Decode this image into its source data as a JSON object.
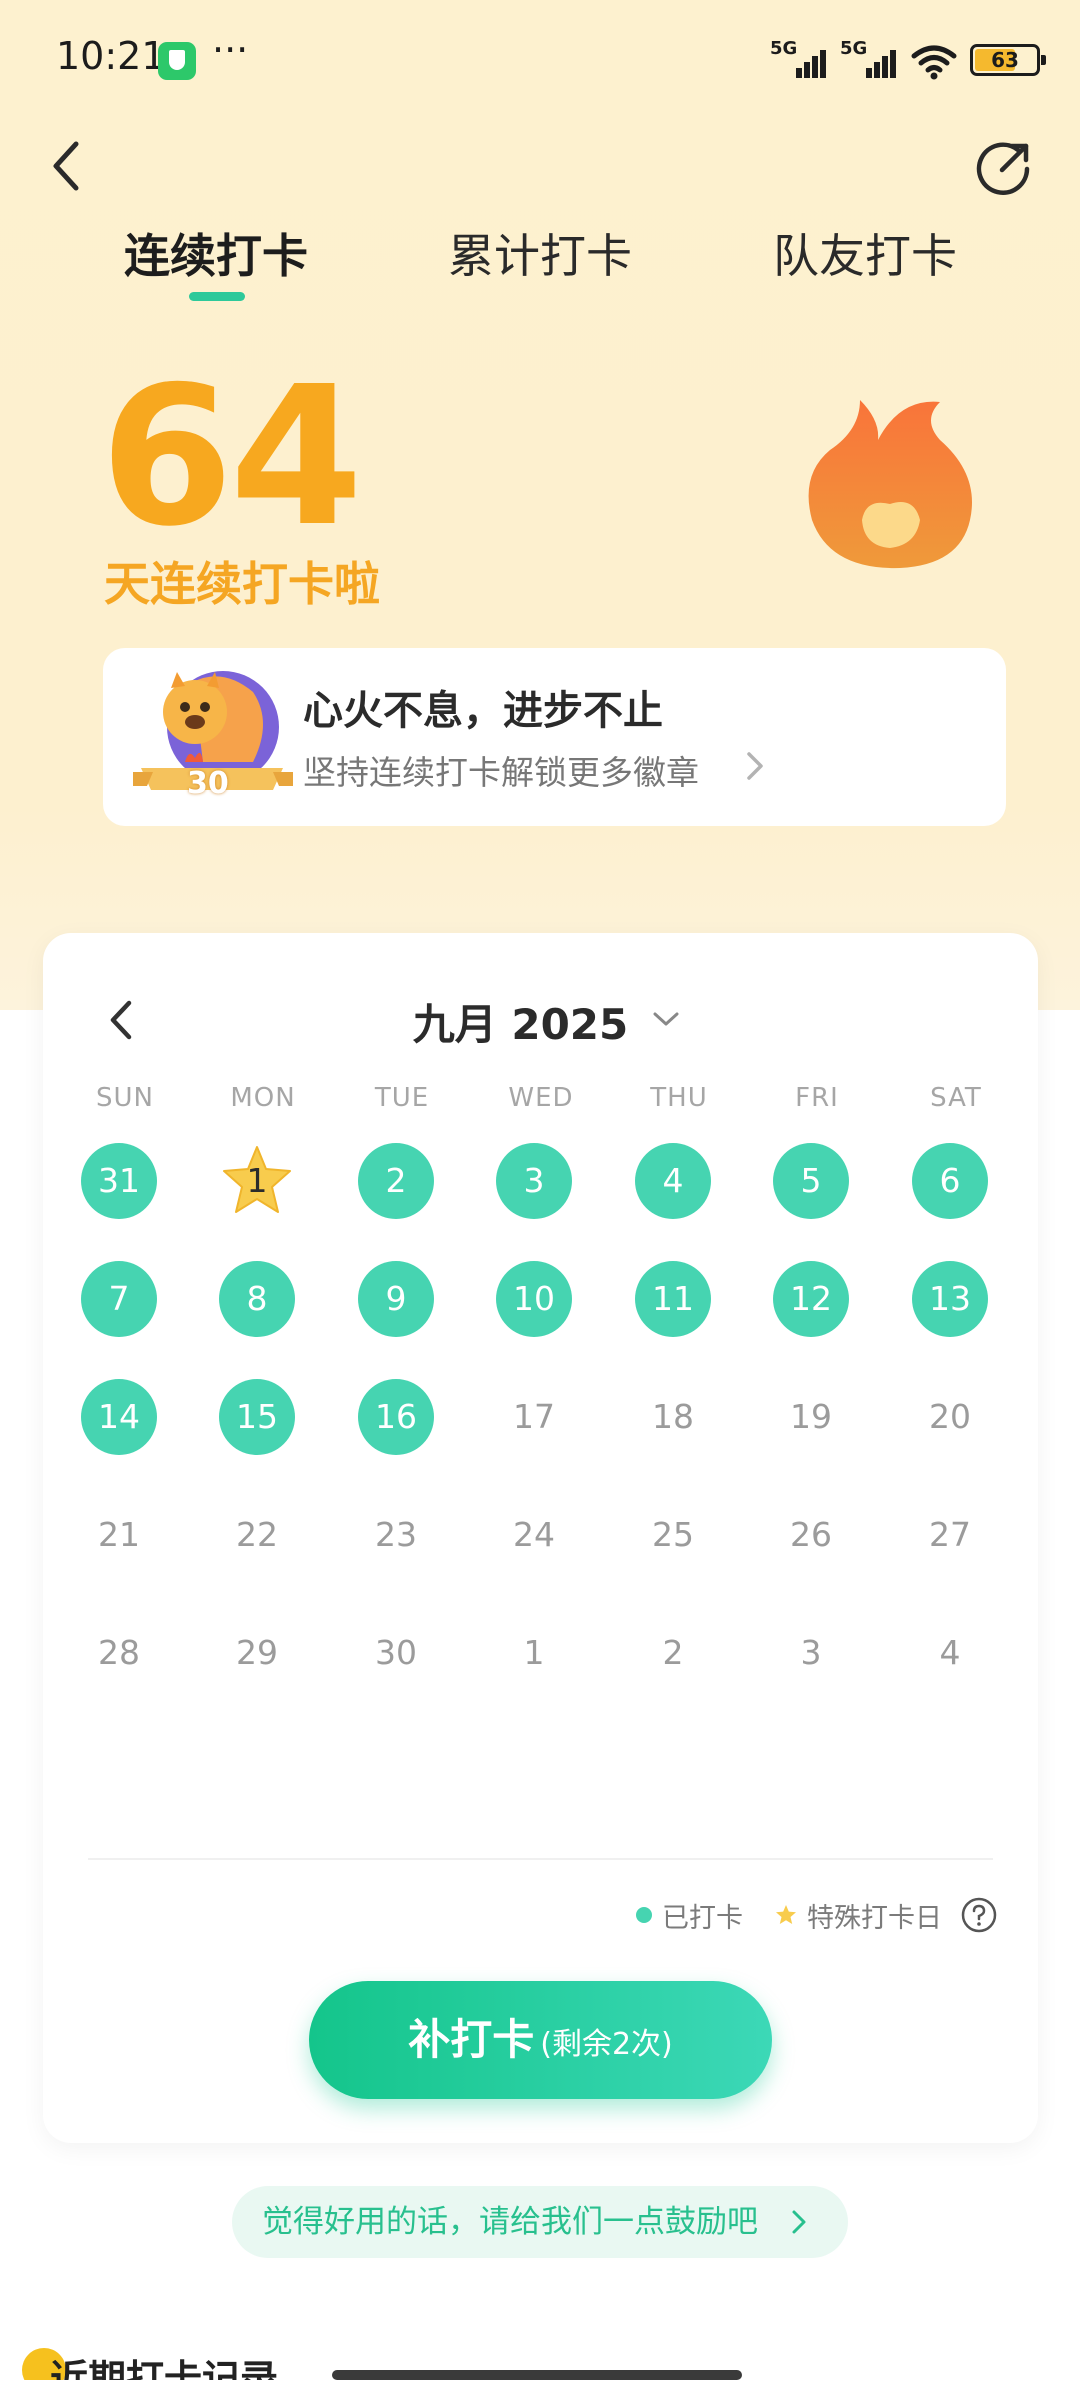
{
  "status_bar": {
    "time": "10:21",
    "dots": "···",
    "signal1_label": "5G",
    "signal2_label": "5G",
    "battery": "63"
  },
  "tabs": [
    {
      "label": "连续打卡",
      "active": true
    },
    {
      "label": "累计打卡",
      "active": false
    },
    {
      "label": "队友打卡",
      "active": false
    }
  ],
  "streak": {
    "count": "64",
    "label": "天连续打卡啦"
  },
  "badge_card": {
    "badge_number": "30",
    "title": "心火不息，进步不止",
    "subtitle": "坚持连续打卡解锁更多徽章"
  },
  "calendar": {
    "month_label": "九月 2025",
    "weekdays": [
      "SUN",
      "MON",
      "TUE",
      "WED",
      "THU",
      "FRI",
      "SAT"
    ],
    "weeks": [
      [
        {
          "d": "31",
          "s": "checked"
        },
        {
          "d": "1",
          "s": "special"
        },
        {
          "d": "2",
          "s": "checked"
        },
        {
          "d": "3",
          "s": "checked"
        },
        {
          "d": "4",
          "s": "checked"
        },
        {
          "d": "5",
          "s": "checked"
        },
        {
          "d": "6",
          "s": "checked"
        }
      ],
      [
        {
          "d": "7",
          "s": "checked"
        },
        {
          "d": "8",
          "s": "checked"
        },
        {
          "d": "9",
          "s": "checked"
        },
        {
          "d": "10",
          "s": "checked"
        },
        {
          "d": "11",
          "s": "checked"
        },
        {
          "d": "12",
          "s": "checked"
        },
        {
          "d": "13",
          "s": "checked"
        }
      ],
      [
        {
          "d": "14",
          "s": "checked"
        },
        {
          "d": "15",
          "s": "checked"
        },
        {
          "d": "16",
          "s": "checked"
        },
        {
          "d": "17",
          "s": "plain"
        },
        {
          "d": "18",
          "s": "plain"
        },
        {
          "d": "19",
          "s": "plain"
        },
        {
          "d": "20",
          "s": "plain"
        }
      ],
      [
        {
          "d": "21",
          "s": "plain"
        },
        {
          "d": "22",
          "s": "plain"
        },
        {
          "d": "23",
          "s": "plain"
        },
        {
          "d": "24",
          "s": "plain"
        },
        {
          "d": "25",
          "s": "plain"
        },
        {
          "d": "26",
          "s": "plain"
        },
        {
          "d": "27",
          "s": "plain"
        }
      ],
      [
        {
          "d": "28",
          "s": "plain"
        },
        {
          "d": "29",
          "s": "plain"
        },
        {
          "d": "30",
          "s": "plain"
        },
        {
          "d": "1",
          "s": "plain"
        },
        {
          "d": "2",
          "s": "plain"
        },
        {
          "d": "3",
          "s": "plain"
        },
        {
          "d": "4",
          "s": "plain"
        }
      ]
    ],
    "legend_checked": "已打卡",
    "legend_special": "特殊打卡日",
    "makeup_label": "补打卡",
    "makeup_remaining": "(剩余2次)"
  },
  "encourage_text": "觉得好用的话，请给我们一点鼓励吧",
  "bottom_partial_text": "近期打卡记录",
  "colors": {
    "accent_green": "#46d4b1",
    "streak_orange": "#f7a81f",
    "special_star": "#f8cc4d",
    "top_background": "#fdf1cf"
  }
}
